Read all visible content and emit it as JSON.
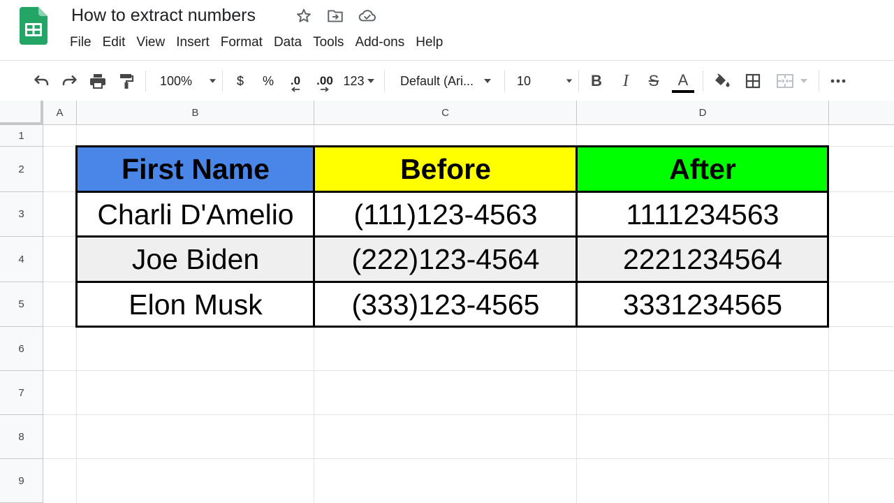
{
  "app": {
    "title": "How to extract numbers",
    "menu": [
      "File",
      "Edit",
      "View",
      "Insert",
      "Format",
      "Data",
      "Tools",
      "Add-ons",
      "Help"
    ]
  },
  "toolbar": {
    "zoom": "100%",
    "currency": "$",
    "percent": "%",
    "decrease_decimal": ".0",
    "increase_decimal": ".00",
    "more_formats": "123",
    "font": "Default (Ari...",
    "font_size": "10",
    "bold": "B",
    "italic": "I",
    "strikethrough": "S",
    "text_color": "A",
    "text_color_value": "#000000"
  },
  "sheet": {
    "columns": [
      "A",
      "B",
      "C",
      "D"
    ],
    "rows": [
      "1",
      "2",
      "3",
      "4",
      "5",
      "6",
      "7",
      "8",
      "9"
    ]
  },
  "table": {
    "headers": [
      {
        "label": "First Name",
        "color": "#4a86e8"
      },
      {
        "label": "Before",
        "color": "#ffff00"
      },
      {
        "label": "After",
        "color": "#00ff00"
      }
    ],
    "alt_row_color": "#efefef",
    "rows": [
      [
        "Charli D'Amelio",
        "(111)123-4563",
        "1111234563"
      ],
      [
        "Joe Biden",
        "(222)123-4564",
        "2221234564"
      ],
      [
        "Elon Musk",
        "(333)123-4565",
        "3331234565"
      ]
    ]
  }
}
